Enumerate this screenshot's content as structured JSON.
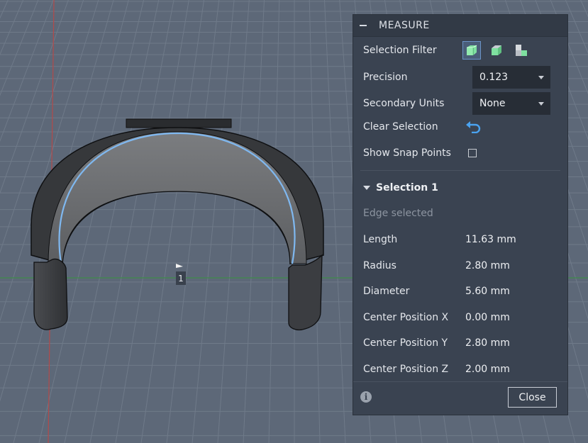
{
  "viewport": {
    "marker_label": "1"
  },
  "measure": {
    "title": "MEASURE",
    "selection_filter_label": "Selection Filter",
    "filters": [
      "body-filter-icon",
      "face-filter-icon",
      "edge-filter-icon"
    ],
    "precision_label": "Precision",
    "precision_value": "0.123",
    "secondary_units_label": "Secondary Units",
    "secondary_units_value": "None",
    "clear_selection_label": "Clear Selection",
    "show_snap_points_label": "Show Snap Points",
    "show_snap_points_checked": false,
    "selection_title": "Selection 1",
    "selection_status": "Edge selected",
    "measurements": [
      {
        "label": "Length",
        "value": "11.63 mm"
      },
      {
        "label": "Radius",
        "value": "2.80 mm"
      },
      {
        "label": "Diameter",
        "value": "5.60 mm"
      },
      {
        "label": "Center Position X",
        "value": "0.00 mm"
      },
      {
        "label": "Center Position Y",
        "value": "2.80 mm"
      },
      {
        "label": "Center Position Z",
        "value": "2.00 mm"
      }
    ],
    "close_label": "Close"
  },
  "colors": {
    "accent": "#4aa3f0",
    "selection_edge": "#7fb8f0",
    "panel_bg": "#3a4351"
  }
}
